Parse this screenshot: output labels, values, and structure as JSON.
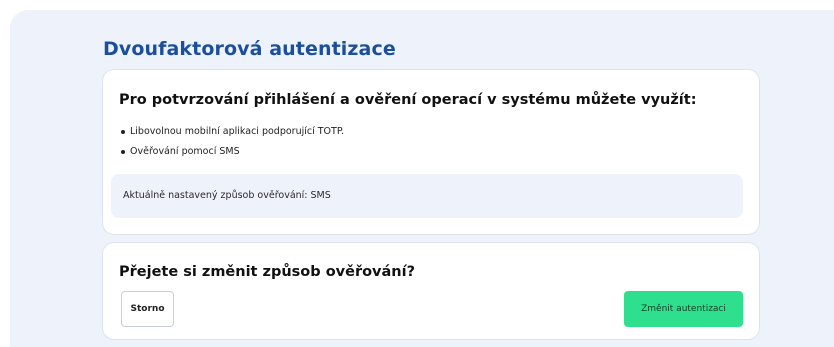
{
  "page": {
    "title": "Dvoufaktorová autentizace"
  },
  "info_card": {
    "heading": "Pro potvrzování přihlášení a ověření operací v systému můžete využít:",
    "options": [
      "Libovolnou mobilní aplikaci podporující TOTP.",
      "Ověřování pomocí SMS"
    ],
    "current_method": "Aktuálně nastavený způsob ověřování: SMS"
  },
  "change_card": {
    "heading": "Přejete si změnit způsob ověřování?",
    "cancel_label": "Storno",
    "confirm_label": "Změnit autentizaci"
  },
  "colors": {
    "title": "#1b4f9c",
    "panel_background": "#eef2fb",
    "confirm_button": "#2ee08e"
  }
}
